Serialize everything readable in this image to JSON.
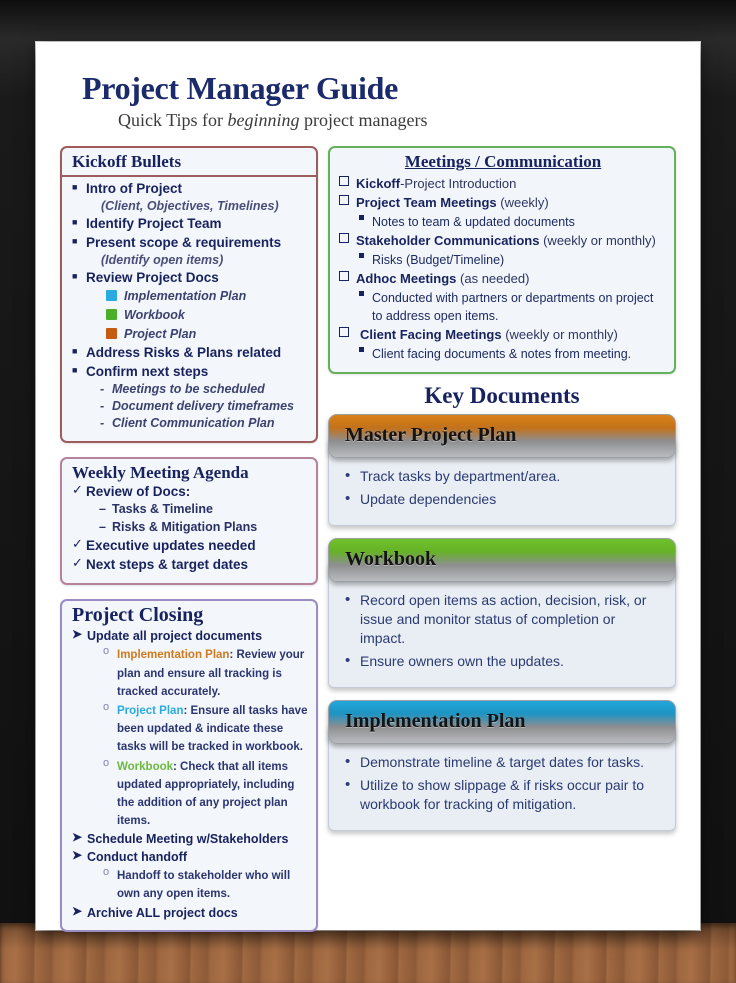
{
  "document": {
    "title": "Project Manager Guide",
    "subtitle_pre": "Quick Tips for ",
    "subtitle_italic": "beginning",
    "subtitle_post": " project managers"
  },
  "colors": {
    "title": "#1b2a6b",
    "kickoff_border": "#9e5c5c",
    "meetings_border": "#63b259",
    "agenda_border": "#b5849c",
    "closing_border": "#9b8cc4",
    "implementation_plan": "#29abe2",
    "workbook": "#6cba3f",
    "project_plan": "#c55a11",
    "card_orange": "#d98218",
    "card_green": "#6fc12b",
    "card_cyan": "#23a7d8"
  },
  "kickoff": {
    "heading": "Kickoff Bullets",
    "items": [
      {
        "text": "Intro of Project",
        "note": "(Client, Objectives, Timelines)"
      },
      {
        "text": "Identify Project Team"
      },
      {
        "text": "Present scope & requirements",
        "note": "(Identify open items)"
      },
      {
        "text": "Review Project Docs",
        "swatches": [
          {
            "label": "Implementation Plan",
            "color": "#29abe2"
          },
          {
            "label": "Workbook",
            "color": "#4caf2a"
          },
          {
            "label": "Project Plan",
            "color": "#c55a11"
          }
        ]
      },
      {
        "text": "Address Risks & Plans related"
      },
      {
        "text": "Confirm next steps",
        "dashes": [
          "Meetings to be scheduled",
          "Document delivery timeframes",
          "Client Communication Plan"
        ]
      }
    ]
  },
  "meetings": {
    "heading": "Meetings / Communication",
    "items": [
      {
        "bold": "Kickoff",
        "light": "-Project Introduction",
        "subs": []
      },
      {
        "bold": "Project Team Meetings",
        "light": " (weekly)",
        "subs": [
          "Notes to team & updated documents"
        ]
      },
      {
        "bold": "Stakeholder Communications",
        "light": " (weekly or monthly)",
        "subs": [
          "Risks (Budget/Timeline)"
        ]
      },
      {
        "bold": "Adhoc Meetings",
        "light": " (as needed)",
        "subs": [
          "Conducted with partners or departments  on project to address open items."
        ]
      },
      {
        "bold": "Client Facing Meetings",
        "light": " (weekly or monthly)",
        "subs": [
          "Client facing documents  & notes from meeting."
        ]
      }
    ]
  },
  "agenda": {
    "heading": "Weekly Meeting Agenda",
    "items": [
      {
        "text": "Review of Docs:",
        "dashes": [
          "Tasks & Timeline",
          "Risks & Mitigation Plans"
        ]
      },
      {
        "text": "Executive updates needed"
      },
      {
        "text": "Next steps & target dates"
      }
    ]
  },
  "closing": {
    "heading": "Project Closing",
    "items": [
      {
        "text": "Update all project documents",
        "subs": [
          {
            "label": "Implementation Plan",
            "label_color": "orange",
            "text": ": Review your plan and ensure all tracking is tracked accurately."
          },
          {
            "label": "Project Plan",
            "label_color": "cyan",
            "text": ": Ensure all tasks have been updated & indicate these tasks will be tracked in workbook."
          },
          {
            "label": "Workbook",
            "label_color": "green",
            "text": ": Check that all items updated appropriately, including the addition of any project plan items."
          }
        ]
      },
      {
        "text": "Schedule Meeting w/Stakeholders"
      },
      {
        "text": "Conduct handoff",
        "subs": [
          {
            "label": "",
            "label_color": "",
            "text": "Handoff to stakeholder who will own any open items."
          }
        ]
      },
      {
        "text": "Archive ALL project docs"
      }
    ]
  },
  "key_documents": {
    "title": "Key Documents",
    "cards": [
      {
        "name": "Master Project Plan",
        "accent": "orange",
        "bullets": [
          "Track tasks by department/area.",
          "Update dependencies"
        ]
      },
      {
        "name": "Workbook",
        "accent": "green",
        "bullets": [
          "Record open items as action, decision, risk, or issue and monitor status of completion or impact.",
          "Ensure owners own the updates."
        ]
      },
      {
        "name": "Implementation Plan",
        "accent": "cyan",
        "bullets": [
          "Demonstrate timeline & target dates for tasks.",
          "Utilize to show slippage & if risks occur pair to workbook for tracking of mitigation."
        ]
      }
    ]
  }
}
